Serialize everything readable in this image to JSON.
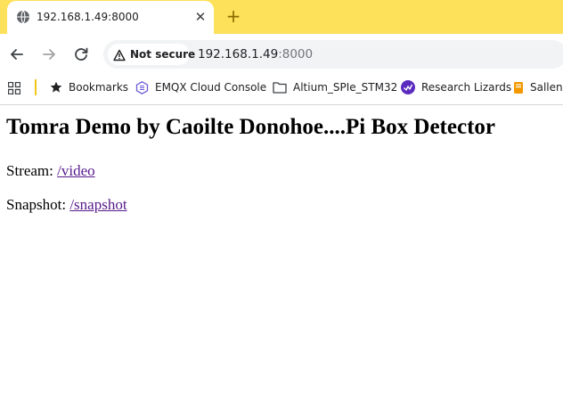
{
  "browser": {
    "tab": {
      "title": "192.168.1.49:8000",
      "favicon": "globe-icon"
    },
    "new_tab_symbol": "+",
    "close_symbol": "✕",
    "address": {
      "security_label": "Not secure",
      "url_host": "192.168.1.49",
      "url_port": ":8000"
    },
    "bookmarks": [
      {
        "label": "Bookmarks",
        "icon": "star-icon"
      },
      {
        "label": "EMQX Cloud Console",
        "icon": "emqx-icon"
      },
      {
        "label": "Altium_SPIe_STM32",
        "icon": "folder-icon"
      },
      {
        "label": "Research Lizards",
        "icon": "research-lizards-icon"
      },
      {
        "label": "Sallenk",
        "icon": "book-icon"
      }
    ],
    "colors": {
      "tabstrip": "#fde15a",
      "link_visited": "#551a8b"
    }
  },
  "page": {
    "title": "Tomra Demo by Caoilte Donohoe....Pi Box Detector",
    "stream": {
      "label": "Stream: ",
      "link": "/video"
    },
    "snapshot": {
      "label": "Snapshot: ",
      "link": "/snapshot"
    }
  }
}
